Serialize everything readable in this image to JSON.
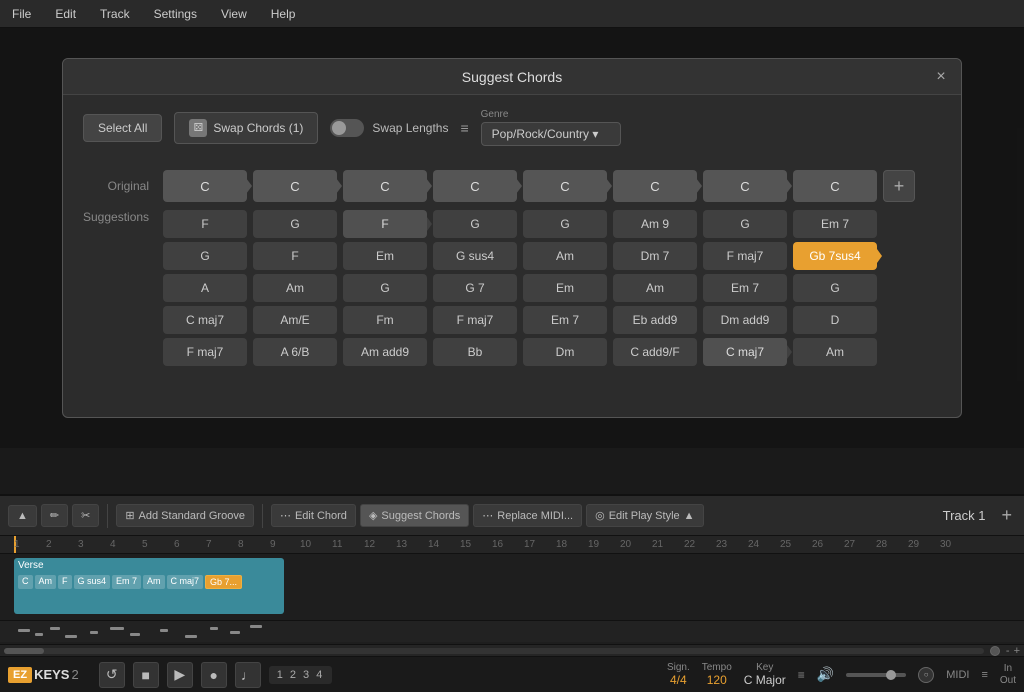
{
  "menubar": {
    "items": [
      "File",
      "Edit",
      "Track",
      "Settings",
      "View",
      "Help"
    ]
  },
  "modal": {
    "title": "Suggest Chords",
    "close_label": "×",
    "toolbar": {
      "select_all": "Select All",
      "swap_chords": "Swap Chords (1)",
      "swap_lengths": "Swap Lengths",
      "genre_label": "Genre",
      "genre_value": "Pop/Rock/Country"
    },
    "original_label": "Original",
    "suggestions_label": "Suggestions",
    "original_chords": [
      "C",
      "C",
      "C",
      "C",
      "C",
      "C",
      "C",
      "C"
    ],
    "suggestion_columns": [
      {
        "chords": [
          "F",
          "G",
          "A",
          "C maj7",
          "F maj7"
        ]
      },
      {
        "chords": [
          "G",
          "F",
          "Am",
          "Am/E",
          "A 6/B"
        ]
      },
      {
        "chords": [
          "F",
          "Em",
          "G",
          "Fm",
          "Am add9"
        ],
        "selected_index": 0
      },
      {
        "chords": [
          "G",
          "G sus4",
          "G 7",
          "F maj7",
          "Bb"
        ]
      },
      {
        "chords": [
          "G",
          "Am",
          "Em",
          "Em 7",
          "Dm"
        ]
      },
      {
        "chords": [
          "Am 9",
          "Dm 7",
          "Am",
          "Eb add9",
          "C add9/F"
        ]
      },
      {
        "chords": [
          "G",
          "F maj7",
          "Em 7",
          "Dm add9",
          "C maj7"
        ],
        "selected_index": 4
      },
      {
        "chords": [
          "Em 7",
          "Gb 7sus4",
          "G",
          "D",
          "Am"
        ],
        "selected_index": 1,
        "highlighted": true
      }
    ],
    "add_button": "+"
  },
  "daw": {
    "tools": [
      {
        "icon": "▲",
        "label": "",
        "name": "select-tool"
      },
      {
        "icon": "✏",
        "label": "",
        "name": "pencil-tool"
      },
      {
        "icon": "✂",
        "label": "",
        "name": "scissor-tool"
      }
    ],
    "buttons": [
      {
        "label": "Add Standard Groove",
        "name": "add-groove-btn"
      },
      {
        "label": "Edit Chord",
        "name": "edit-chord-btn"
      },
      {
        "label": "Suggest Chords",
        "name": "suggest-chords-btn",
        "active": true
      },
      {
        "label": "Replace MIDI...",
        "name": "replace-midi-btn"
      },
      {
        "label": "Edit Play Style",
        "name": "edit-play-style-btn"
      }
    ],
    "track_label": "Track 1",
    "add_track": "+",
    "timeline": {
      "marks": [
        1,
        2,
        3,
        4,
        5,
        6,
        7,
        8,
        9,
        10,
        11,
        12,
        13,
        14,
        15,
        16,
        17,
        18,
        19,
        20,
        21,
        22,
        23,
        24,
        25,
        26,
        27,
        28,
        29,
        30
      ]
    },
    "track_block": {
      "label": "Verse",
      "chords": [
        "C",
        "Am",
        "F",
        "G sus4",
        "Em 7",
        "Am",
        "C maj7",
        "Gb 7..."
      ]
    },
    "status_bar": {
      "logo_ez": "EZ",
      "logo_keys": "KEYS",
      "logo_num": "2",
      "transport_nums": "1 2 3 4",
      "signature_label": "Sign.",
      "signature_value": "4/4",
      "tempo_label": "Tempo",
      "tempo_value": "120",
      "key_label": "Key",
      "key_value": "C Major",
      "midi_label": "MIDI",
      "in_label": "In",
      "out_label": "Out"
    }
  }
}
